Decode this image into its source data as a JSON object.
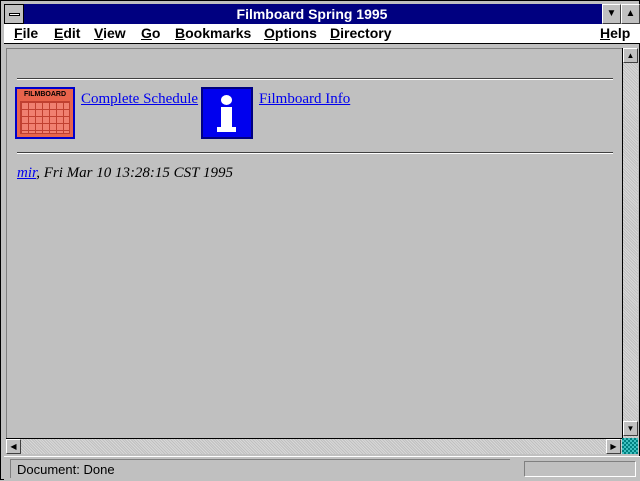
{
  "window": {
    "title": "Filmboard Spring 1995"
  },
  "menu": {
    "items": [
      {
        "label": "File"
      },
      {
        "label": "Edit"
      },
      {
        "label": "View"
      },
      {
        "label": "Go"
      },
      {
        "label": "Bookmarks"
      },
      {
        "label": "Options"
      },
      {
        "label": "Directory"
      },
      {
        "label": "Help"
      }
    ]
  },
  "content": {
    "schedule_link": "Complete Schedule",
    "calendar_icon_label": "FILMBOARD",
    "info_link": "Filmboard Info",
    "author_link": "mir",
    "timestamp": ", Fri Mar 10 13:28:15 CST 1995"
  },
  "status": {
    "text": "Document: Done",
    "progress": 0
  },
  "icons": {
    "system_menu": "system-menu-icon",
    "minimize": "triangle-down-icon",
    "maximize": "triangle-up-icon",
    "calendar": "calendar-icon",
    "info": "info-icon"
  },
  "colors": {
    "titlebar": "#000080",
    "background": "#c0c0c0",
    "link": "#0000ee",
    "calendar": "#e8644c",
    "info": "#0000ee"
  }
}
